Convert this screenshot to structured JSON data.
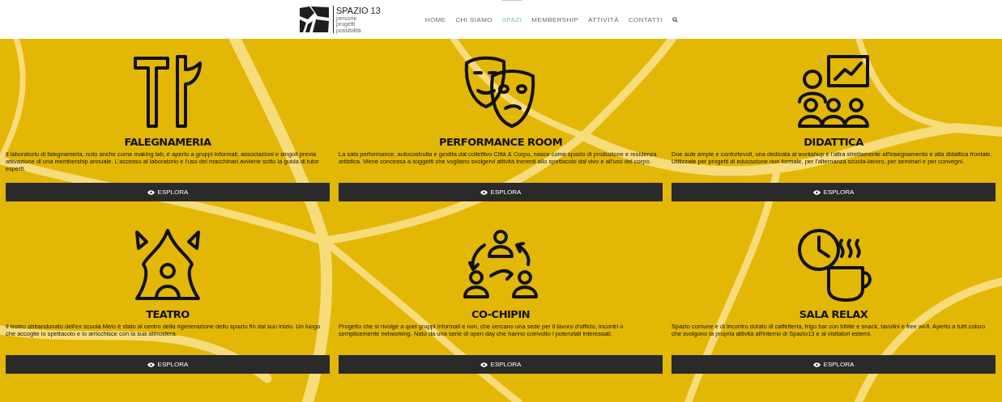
{
  "logo": {
    "name": "SPAZIO 13",
    "tagline": [
      "persone",
      "progetti",
      "possibilità"
    ]
  },
  "nav": [
    {
      "label": "HOME",
      "selected": false
    },
    {
      "label": "CHI SIAMO",
      "selected": false
    },
    {
      "label": "SPAZI",
      "selected": true
    },
    {
      "label": "MEMBERSHIP",
      "selected": false
    },
    {
      "label": "ATTIVITÀ",
      "selected": false
    },
    {
      "label": "CONTATTI",
      "selected": false
    }
  ],
  "spaces": [
    {
      "title": "FALEGNAMERIA",
      "description": "Il laboratorio di falegnameria, noto anche come making lab, è aperto a gruppi informali, associazioni e singoli previa attivazione di una membership annuale. L'accesso al laboratorio e l'uso dei macchinari avviene sotto la guida di tutor esperti.",
      "button": "ESPLORA"
    },
    {
      "title": "PERFORMANCE ROOM",
      "description": "La sala performance, autocostruita e gestita dal collettivo Città & Corpo, nasce come spazio di produzione e residenza artistica. Viene concessa a soggetti che vogliano svolgervi attività inerenti allo spettacolo dal vivo e all'uso del corpo.",
      "button": "ESPLORA"
    },
    {
      "title": "DIDATTICA",
      "description": "Due aule ampie e confortevoli, una dedicata al workshop e l'altra strettamente all'insegnamento e alla didattica frontale. Utilizzate per progetti di educazione non formale, per l'alternanza scuola-lavoro, per seminari e per convegni.",
      "button": "ESPLORA"
    },
    {
      "title": "TEATRO",
      "description": "Il teatro abbandonato dell'ex scuola Melo è stato al centro della rigenerazione dello spazio fin dal suo inizio. Un luogo che accoglie lo spettacolo e lo arricchisce con la sua atmosfera.",
      "button": "ESPLORA"
    },
    {
      "title": "CO-CHIPIN",
      "description": "Progetto che si rivolge a quei gruppi informali e non, che cercano una sede per il lavoro d'ufficio, incontri o semplicemente networking. Nato da una serie di open day che hanno coinvolto i potenziali interessati.",
      "button": "ESPLORA"
    },
    {
      "title": "SALA RELAX",
      "description": "Spazio comune e di incontro dotato di caffetteria, frigo bar con bibite e snack, tavolini e free wi-fi. Aperto a tutti coloro che svolgono la propria attività all'interno di Spazio13 e ai visitatori esterni.",
      "button": "ESPLORA"
    }
  ]
}
